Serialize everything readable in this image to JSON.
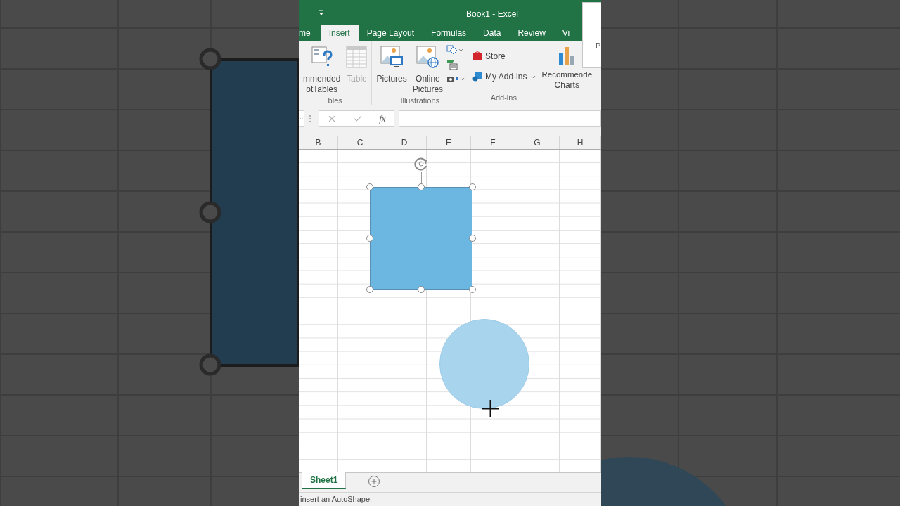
{
  "window": {
    "title": "Book1 - Excel"
  },
  "tabs": [
    {
      "label": "me",
      "selected": false
    },
    {
      "label": "Insert",
      "selected": true
    },
    {
      "label": "Page Layout",
      "selected": false
    },
    {
      "label": "Formulas",
      "selected": false
    },
    {
      "label": "Data",
      "selected": false
    },
    {
      "label": "Review",
      "selected": false
    },
    {
      "label": "Vi",
      "selected": false
    }
  ],
  "popup": {
    "text": "P"
  },
  "ribbon": {
    "groups": [
      {
        "label": "bles",
        "items": [
          {
            "kind": "pivot",
            "lines": [
              "mmended",
              "otTables"
            ],
            "disabled": false
          },
          {
            "kind": "table",
            "lines": [
              "Table"
            ],
            "disabled": true
          }
        ]
      },
      {
        "label": "Illustrations",
        "items": [
          {
            "kind": "pictures",
            "lines": [
              "Pictures"
            ],
            "disabled": false
          },
          {
            "kind": "online",
            "lines": [
              "Online",
              "Pictures"
            ],
            "disabled": false
          },
          {
            "kind": "stack",
            "disabled": false
          }
        ]
      },
      {
        "label": "Add-ins",
        "items": [
          {
            "kind": "addins",
            "lines": [
              "Store",
              "My Add-ins"
            ],
            "disabled": false
          }
        ]
      },
      {
        "items": [
          {
            "kind": "charts",
            "lines": [
              "Recommende",
              "Charts"
            ],
            "disabled": false
          }
        ]
      }
    ]
  },
  "formula_bar": {
    "function_label": "fx"
  },
  "columns": [
    "B",
    "C",
    "D",
    "E",
    "F",
    "G",
    "H"
  ],
  "shapes": [
    {
      "kind": "rectangle",
      "selected": true
    },
    {
      "kind": "ellipse",
      "selected": false
    }
  ],
  "sheet_tabs": [
    {
      "label": "Sheet1",
      "selected": true
    }
  ],
  "status_bar": {
    "text": "insert an AutoShape."
  }
}
